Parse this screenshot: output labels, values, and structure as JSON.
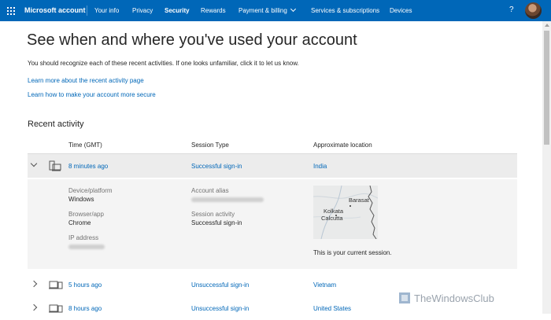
{
  "nav": {
    "brand": "Microsoft account",
    "items": [
      "Your info",
      "Privacy",
      "Security",
      "Rewards",
      "Payment & billing",
      "Services & subscriptions",
      "Devices"
    ],
    "active": "Security",
    "help": "?"
  },
  "page": {
    "title": "See when and where you've used your account",
    "intro": "You should recognize each of these recent activities. If one looks unfamiliar, click it to let us know.",
    "link1": "Learn more about the recent activity page",
    "link2": "Learn how to make your account more secure",
    "section": "Recent activity"
  },
  "table": {
    "headers": [
      "Time (GMT)",
      "Session Type",
      "Approximate location"
    ],
    "rows": [
      {
        "time": "8 minutes ago",
        "session": "Successful sign-in",
        "location": "India",
        "expanded": true
      },
      {
        "time": "5 hours ago",
        "session": "Unsuccessful sign-in",
        "location": "Vietnam",
        "expanded": false
      },
      {
        "time": "8 hours ago",
        "session": "Unsuccessful sign-in",
        "location": "United States",
        "expanded": false
      }
    ]
  },
  "details": {
    "device_label": "Device/platform",
    "device_value": "Windows",
    "browser_label": "Browser/app",
    "browser_value": "Chrome",
    "ip_label": "IP address",
    "alias_label": "Account alias",
    "activity_label": "Session activity",
    "activity_value": "Successful sign-in",
    "map_labels": [
      "Barasat",
      "Kolkata",
      "Calcutta"
    ],
    "current_session": "This is your current session."
  },
  "watermark": "TheWindowsClub",
  "colors": {
    "accent": "#0067b8",
    "expanded_row": "#ececec"
  }
}
